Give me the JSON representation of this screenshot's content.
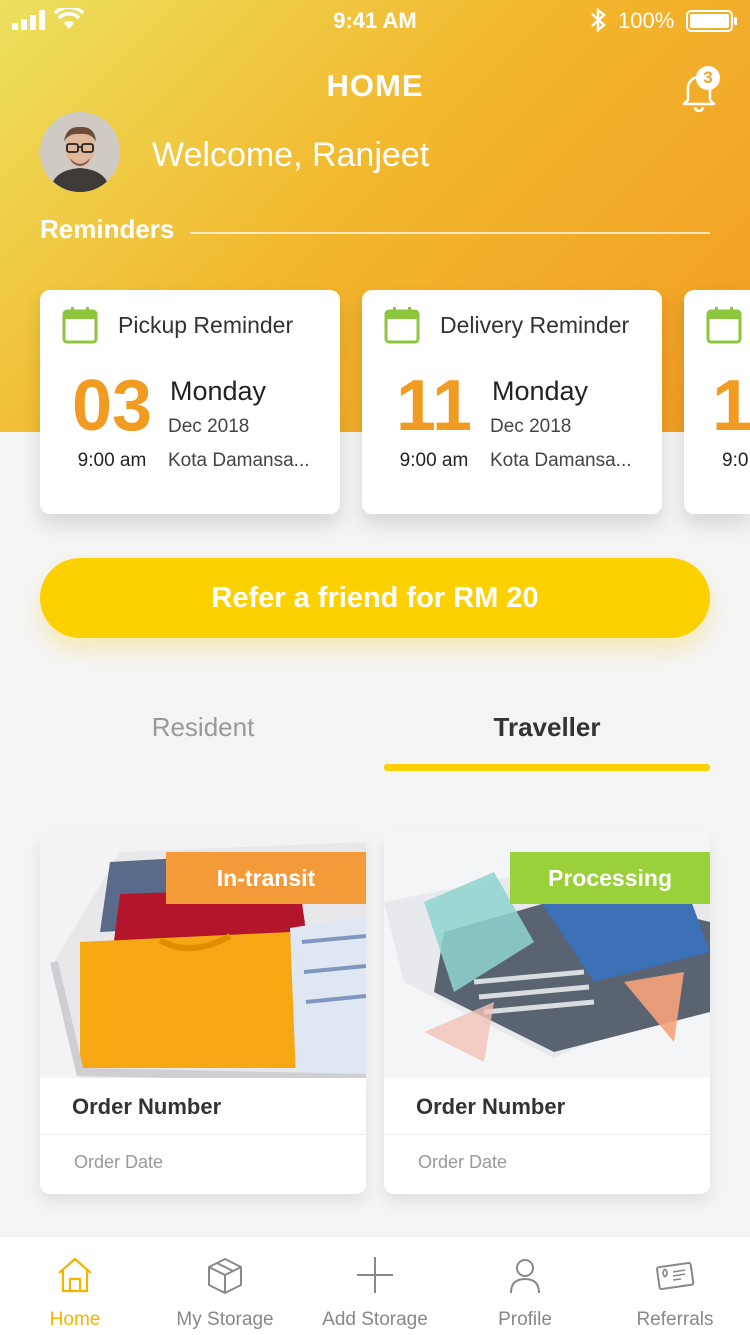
{
  "status_bar": {
    "time": "9:41 AM",
    "battery": "100%"
  },
  "header": {
    "title": "HOME",
    "notification_count": "3",
    "welcome": "Welcome, Ranjeet"
  },
  "reminders": {
    "label": "Reminders",
    "cards": [
      {
        "title": "Pickup Reminder",
        "day": "03",
        "weekday": "Monday",
        "date": "Dec 2018",
        "time": "9:00 am",
        "location": "Kota Damansa..."
      },
      {
        "title": "Delivery Reminder",
        "day": "11",
        "weekday": "Monday",
        "date": "Dec 2018",
        "time": "9:00 am",
        "location": "Kota Damansa..."
      },
      {
        "title": "",
        "day": "1",
        "weekday": "",
        "date": "",
        "time": "9:0",
        "location": ""
      }
    ]
  },
  "refer": {
    "label": "Refer a friend for RM 20"
  },
  "tabs": [
    {
      "label": "Resident"
    },
    {
      "label": "Traveller"
    }
  ],
  "orders": [
    {
      "status": "In-transit",
      "status_color": "#f29b38",
      "number_label": "Order Number",
      "date_label": "Order Date"
    },
    {
      "status": "Processing",
      "status_color": "#9ad03a",
      "number_label": "Order Number",
      "date_label": "Order Date"
    }
  ],
  "bottom_nav": [
    {
      "label": "Home",
      "icon": "home-icon",
      "active": true
    },
    {
      "label": "My Storage",
      "icon": "box-icon"
    },
    {
      "label": "Add Storage",
      "icon": "plus-icon"
    },
    {
      "label": "Profile",
      "icon": "person-icon"
    },
    {
      "label": "Referrals",
      "icon": "ticket-icon"
    }
  ],
  "colors": {
    "accent": "#fdd000",
    "orange": "#f29b22",
    "calendar_green": "#8cc63f"
  }
}
